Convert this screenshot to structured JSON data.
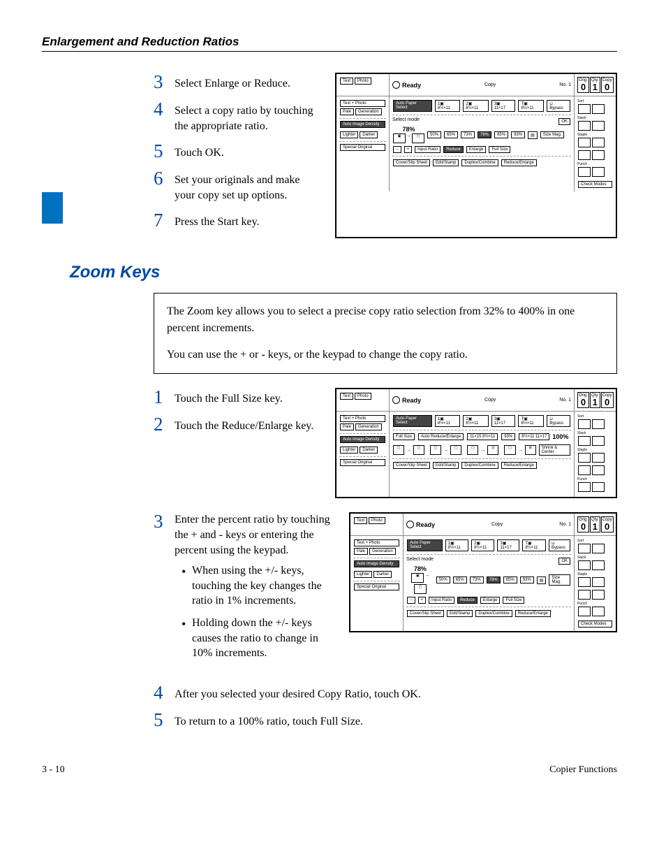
{
  "header": {
    "title": "Enlargement and Reduction Ratios"
  },
  "section1_steps": [
    {
      "num": "3",
      "text": "Select Enlarge or Reduce."
    },
    {
      "num": "4",
      "text": "Select a copy ratio by touching the appropriate ratio."
    },
    {
      "num": "5",
      "text": "Touch OK."
    },
    {
      "num": "6",
      "text": "Set your originals and make your copy set up options."
    },
    {
      "num": "7",
      "text": "Press the Start key."
    }
  ],
  "zoom_heading": "Zoom Keys",
  "zoom_box": {
    "p1": "The Zoom key allows you to select a precise copy ratio selection from 32% to 400% in one percent increments.",
    "p2": "You can use the + or - keys, or the keypad to change the copy ratio."
  },
  "section2_steps_a": [
    {
      "num": "1",
      "text": "Touch the Full Size key."
    },
    {
      "num": "2",
      "text": "Touch the Reduce/Enlarge key."
    }
  ],
  "section2_step3": {
    "num": "3",
    "text": "Enter the percent ratio by touching the + and - keys or entering the percent using the keypad.",
    "bullets": [
      "When using the +/- keys, touching the key changes the ratio in 1% increments.",
      "Holding down the +/- keys causes the ratio to change in 10% increments."
    ]
  },
  "section2_steps_b": [
    {
      "num": "4",
      "text": "After you selected your desired Copy Ratio, touch OK."
    },
    {
      "num": "5",
      "text": "To return to a 100% ratio, touch Full Size."
    }
  ],
  "footer": {
    "left": "3 - 10",
    "right": "Copier Functions"
  },
  "panel": {
    "ready": "Ready",
    "copy": "Copy",
    "no": "No. 1",
    "orig": "Orig.",
    "qty": "Qty.",
    "copy_lbl": "Copy",
    "zero": "0",
    "one": "1",
    "text": "Text",
    "photo": "Photo",
    "textphoto": "Text + Photo",
    "pale": "Pale",
    "generation": "Generation",
    "autoimg": "Auto Image Density",
    "lighter": "Lighter",
    "darker": "Darker",
    "special": "Special Original",
    "autopaper": "Auto Paper Select",
    "size1": "8½×11",
    "size2": "11×17",
    "bypass": "Bypass",
    "selectmode": "Select mode",
    "pct78": "78%",
    "pct93": "93%",
    "pct100": "100%",
    "ok": "OK",
    "sizemag": "Size Mag.",
    "minus": "−",
    "plus": "+",
    "inputratio": "Input Ratio",
    "reduce": "Reduce",
    "enlarge": "Enlarge",
    "fullsize": "Full Size",
    "cover": "Cover/Slip Sheet",
    "edit": "Edit/Stamp",
    "duplex": "Duplex/Combine",
    "redenl": "Reduce/Enlarge",
    "autore": "Auto Reduce/Enlarge",
    "shrink": "Shrink & Center",
    "check": "Check Modes",
    "sort": "Sort",
    "stack": "Stack",
    "staple": "Staple",
    "punch": "Punch",
    "r50": "50%",
    "r65": "65%",
    "r73": "73%",
    "r78": "78%",
    "r85": "85%",
    "r93": "93%",
    "ratio1": "11×15 8½×11",
    "ratio2": "8½×11 11×17"
  }
}
